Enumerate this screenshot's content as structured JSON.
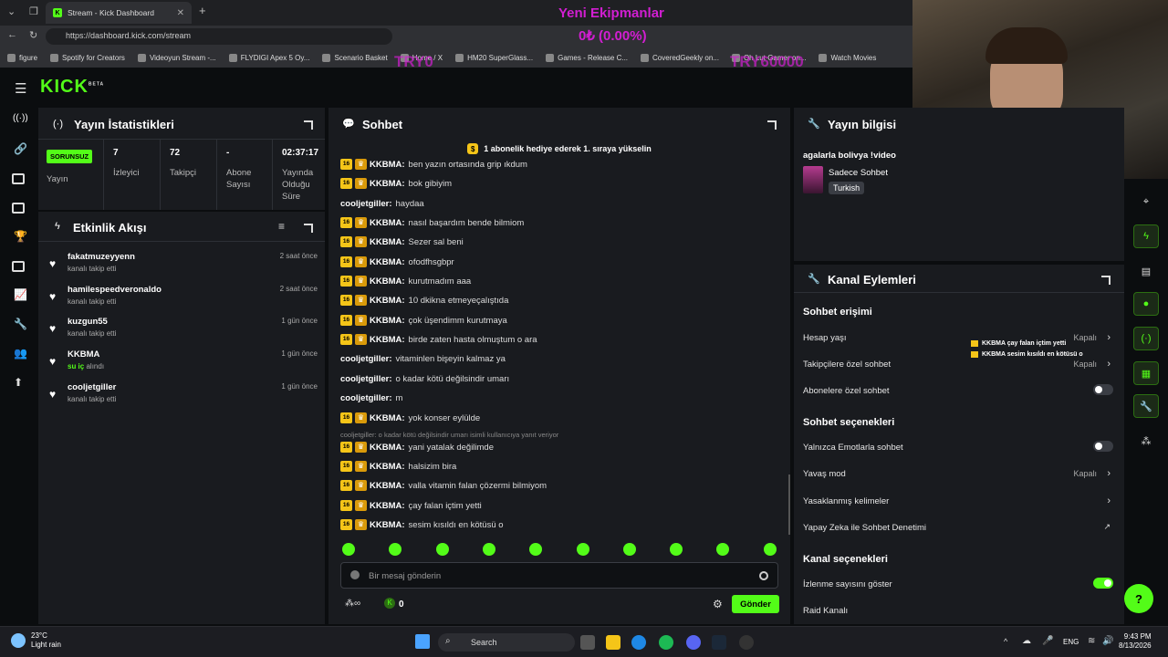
{
  "browser": {
    "tab_title": "Stream - Kick Dashboard",
    "url": "https://dashboard.kick.com/stream",
    "bookmarks": [
      "figure",
      "Spotify for Creators",
      "Videoyun Stream -...",
      "FLYDIGI Apex 5 Oy...",
      "Scenario Basket",
      "Home / X",
      "HM20 SuperGlass...",
      "Games - Release C...",
      "CoveredGeekly on...",
      "Oh Lut Gamer on...",
      "Watch Movies"
    ]
  },
  "overlay": {
    "line1": "Yeni Ekipmanlar",
    "line2": "0₺ (0.00%)",
    "left_amount": "TRY0",
    "right_amount": "TRY60000"
  },
  "header": {
    "logo": "KICK",
    "logo_tag": "BETA"
  },
  "stats": {
    "title": "Yayın İstatistikleri",
    "status_badge": "SORUNSUZ",
    "stream_label": "Yayın",
    "items": [
      {
        "value": "7",
        "label": "İzleyici"
      },
      {
        "value": "72",
        "label": "Takipçi"
      },
      {
        "value": "-",
        "label": "Abone Sayısı"
      },
      {
        "value": "02:37:17",
        "label": "Yayında Olduğu Süre"
      }
    ]
  },
  "activity": {
    "title": "Etkinlik Akışı",
    "items": [
      {
        "name": "fakatmuzeyyenn",
        "desc": "kanalı takip etti",
        "time": "2 saat önce"
      },
      {
        "name": "hamilespeedveronaldo",
        "desc": "kanalı takip etti",
        "time": "2 saat önce"
      },
      {
        "name": "kuzgun55",
        "desc": "kanalı takip etti",
        "time": "1 gün önce"
      },
      {
        "name": "KKBMA",
        "desc_highlight": "su iç",
        "desc": "alındı",
        "time": "1 gün önce"
      },
      {
        "name": "cooljetgiller",
        "desc": "kanalı takip etti",
        "time": "1 gün önce"
      }
    ]
  },
  "chat": {
    "title": "Sohbet",
    "pinned": "1 abonelik hediye ederek 1. sıraya yükselin",
    "badge_text": "16",
    "messages": [
      {
        "user": "KKBMA",
        "text": "ben yazın ortasında grip ıkdum",
        "badges": true
      },
      {
        "user": "KKBMA",
        "text": "bok gibiyim",
        "badges": true
      },
      {
        "user": "cooljetgiller",
        "text": "haydaa",
        "badges": false
      },
      {
        "user": "KKBMA",
        "text": "nasıl başardım bende bilmiom",
        "badges": true
      },
      {
        "user": "KKBMA",
        "text": "Sezer sal beni",
        "badges": true
      },
      {
        "user": "KKBMA",
        "text": "ofodfhsgbpr",
        "badges": true
      },
      {
        "user": "KKBMA",
        "text": "kurutmadım aaa",
        "badges": true
      },
      {
        "user": "KKBMA",
        "text": "10 dkikna etmeyeçalıştıda",
        "badges": true
      },
      {
        "user": "KKBMA",
        "text": "çok üşendimm kurutmaya",
        "badges": true
      },
      {
        "user": "KKBMA",
        "text": "birde zaten hasta olmuştum o ara",
        "badges": true
      },
      {
        "user": "cooljetgiller",
        "text": "vitaminlen bişeyin kalmaz ya",
        "badges": false
      },
      {
        "user": "cooljetgiller",
        "text": "o kadar kötü değilsindir umarı",
        "badges": false
      },
      {
        "user": "cooljetgiller",
        "text": "m",
        "badges": false
      },
      {
        "user": "KKBMA",
        "text": "yok konser eylülde",
        "badges": true
      },
      {
        "user": "KKBMA",
        "text": "yani yatalak değilimde",
        "badges": true
      },
      {
        "user": "KKBMA",
        "text": "halsizim bira",
        "badges": true
      },
      {
        "user": "KKBMA",
        "text": "valla vitamin falan çözermi bilmiyom",
        "badges": true
      },
      {
        "user": "KKBMA",
        "text": "çay falan içtim yetti",
        "badges": true
      },
      {
        "user": "KKBMA",
        "text": "sesim kısıldı en kötüsü o",
        "badges": true
      }
    ],
    "reply_note": "cooljetgiller: o kadar kötü değilsindir umarı isimli kullanıcıya yanıt veriyor",
    "input_placeholder": "Bir mesaj gönderin",
    "points": "0",
    "send_label": "Gönder"
  },
  "stream_info": {
    "title_header": "Yayın bilgisi",
    "stream_title": "agalarla bolivya !video",
    "category": "Sadece Sohbet",
    "tag": "Turkish"
  },
  "channel_actions": {
    "title": "Kanal Eylemleri",
    "chat_access": "Sohbet erişimi",
    "account_age": "Hesap yaşı",
    "account_age_value": "Kapalı",
    "followers_only": "Takipçilere özel sohbet",
    "followers_only_value": "Kapalı",
    "subs_only": "Abonelere özel sohbet",
    "chat_options": "Sohbet seçenekleri",
    "emote_only": "Yalnızca Emotlarla sohbet",
    "slow_mode": "Yavaş mod",
    "slow_mode_value": "Kapalı",
    "banned_words": "Yasaklanmış kelimeler",
    "ai_moderation": "Yapay Zeka ile Sohbet Denetimi",
    "channel_options": "Kanal seçenekleri",
    "show_viewers": "İzlenme sayısını göster",
    "raid_channel": "Raid Kanalı"
  },
  "alerts": [
    "KKBMA  çay falan içtim yetti",
    "KKBMA  sesim kısıldı en kötüsü o"
  ],
  "taskbar": {
    "temp": "23°C",
    "weather": "Light rain",
    "search": "Search",
    "lang": "ENG",
    "time": "9:43 PM",
    "date": "8/13/2026"
  },
  "colors": {
    "accent": "#53fc18",
    "panel": "#191b1f",
    "background": "#0b0d0f",
    "overlay": "#d21ed2"
  }
}
